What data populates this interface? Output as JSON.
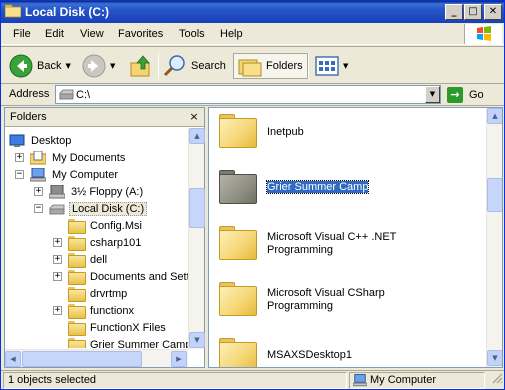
{
  "window": {
    "title": "Local Disk (C:)",
    "controls": {
      "minimize": "_",
      "maximize": "□",
      "close": "✕"
    }
  },
  "menu": [
    "File",
    "Edit",
    "View",
    "Favorites",
    "Tools",
    "Help"
  ],
  "toolbar": {
    "back_label": "Back",
    "search_label": "Search",
    "folders_label": "Folders"
  },
  "address": {
    "label": "Address",
    "value": "C:\\",
    "go_label": "Go"
  },
  "folders_pane": {
    "title": "Folders",
    "close": "×",
    "tree": [
      {
        "label": "Desktop",
        "icon": "desktop-icon",
        "expander": ""
      },
      {
        "label": "My Documents",
        "icon": "my-documents-icon",
        "expander": "+"
      },
      {
        "label": "My Computer",
        "icon": "my-computer-icon",
        "expander": "−"
      },
      {
        "label": "3½ Floppy (A:)",
        "icon": "floppy-icon",
        "expander": "+"
      },
      {
        "label": "Local Disk (C:)",
        "icon": "local-disk-icon",
        "expander": "−"
      },
      {
        "label": "Config.Msi",
        "icon": "folder-icon",
        "expander": ""
      },
      {
        "label": "csharp101",
        "icon": "folder-icon",
        "expander": "+"
      },
      {
        "label": "dell",
        "icon": "folder-icon",
        "expander": "+"
      },
      {
        "label": "Documents and Setti",
        "icon": "folder-icon",
        "expander": "+"
      },
      {
        "label": "drvrtmp",
        "icon": "folder-icon",
        "expander": ""
      },
      {
        "label": "functionx",
        "icon": "folder-icon",
        "expander": "+"
      },
      {
        "label": "FunctionX Files",
        "icon": "folder-icon",
        "expander": ""
      },
      {
        "label": "Grier Summer Camp",
        "icon": "folder-icon",
        "expander": ""
      }
    ]
  },
  "content": {
    "items": [
      {
        "name_line1": "Inetpub",
        "name_line2": "",
        "selected": false
      },
      {
        "name_line1": "Grier Summer Camp",
        "name_line2": "",
        "selected": true
      },
      {
        "name_line1": "Microsoft Visual C++ .NET",
        "name_line2": "Programming",
        "selected": false
      },
      {
        "name_line1": "Microsoft Visual CSharp",
        "name_line2": "Programming",
        "selected": false
      },
      {
        "name_line1": "MSAXSDesktop1",
        "name_line2": "",
        "selected": false
      }
    ]
  },
  "status": {
    "objects": "1 objects selected",
    "location": "My Computer"
  },
  "colors": {
    "titlebar": "#1941b8",
    "selection": "#316ac5",
    "chrome": "#ece9d8"
  }
}
